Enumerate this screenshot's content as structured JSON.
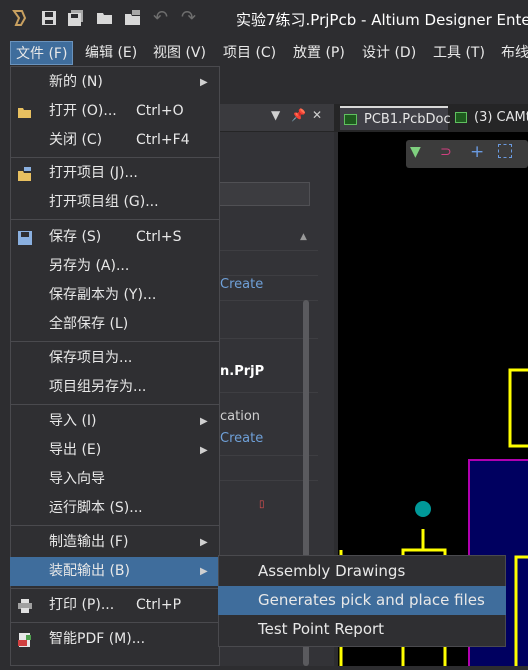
{
  "app": {
    "title": "实验7练习.PrjPcb - Altium Designer Enter",
    "toolbar_icons": [
      "altium-logo-icon",
      "save-icon",
      "save-all-icon",
      "open-folder-icon",
      "open-project-icon",
      "undo-icon",
      "redo-icon"
    ]
  },
  "menubar": {
    "items": [
      {
        "label": "文件 (F)",
        "active": true
      },
      {
        "label": "编辑 (E)"
      },
      {
        "label": "视图 (V)"
      },
      {
        "label": "项目 (C)"
      },
      {
        "label": "放置 (P)"
      },
      {
        "label": "设计 (D)"
      },
      {
        "label": "工具 (T)"
      },
      {
        "label": "布线"
      }
    ]
  },
  "file_menu": {
    "items": [
      {
        "label": "新的 (N)",
        "shortcut": "",
        "submenu": true
      },
      {
        "label": "打开 (O)...",
        "shortcut": "Ctrl+O",
        "icon": "open-folder-icon"
      },
      {
        "label": "关闭 (C)",
        "shortcut": "Ctrl+F4"
      },
      {
        "label": "打开项目 (J)...",
        "icon": "open-project-icon"
      },
      {
        "label": "打开项目组 (G)..."
      },
      {
        "label": "保存 (S)",
        "shortcut": "Ctrl+S",
        "icon": "save-icon"
      },
      {
        "label": "另存为 (A)..."
      },
      {
        "label": "保存副本为 (Y)..."
      },
      {
        "label": "全部保存 (L)"
      },
      {
        "label": "保存项目为..."
      },
      {
        "label": "项目组另存为..."
      },
      {
        "label": "导入 (I)",
        "submenu": true
      },
      {
        "label": "导出 (E)",
        "submenu": true
      },
      {
        "label": "导入向导"
      },
      {
        "label": "运行脚本 (S)..."
      },
      {
        "label": "制造输出 (F)",
        "submenu": true
      },
      {
        "label": "装配输出 (B)",
        "submenu": true,
        "highlighted": true
      },
      {
        "label": "打印 (P)...",
        "shortcut": "Ctrl+P",
        "icon": "printer-icon"
      },
      {
        "label": "智能PDF (M)...",
        "icon": "pdf-icon"
      }
    ]
  },
  "assembly_submenu": {
    "items": [
      {
        "label": "Assembly Drawings"
      },
      {
        "label": "Generates pick and place files",
        "highlighted": true
      },
      {
        "label": "Test Point Report"
      }
    ]
  },
  "panel": {
    "text_create_1": "Create",
    "text_prj": "n.PrjP",
    "text_cation": "cation",
    "text_create_2": "Create"
  },
  "doc_tabs": [
    {
      "label": "PCB1.PcbDoc"
    },
    {
      "label": "(3) CAMt"
    }
  ],
  "colors": {
    "menu_bg": "#2f2f32",
    "highlight": "#3f6d9c",
    "pcb_track": "#ffff00",
    "pcb_outline": "#b000b0",
    "pcb_via": "#009999"
  }
}
